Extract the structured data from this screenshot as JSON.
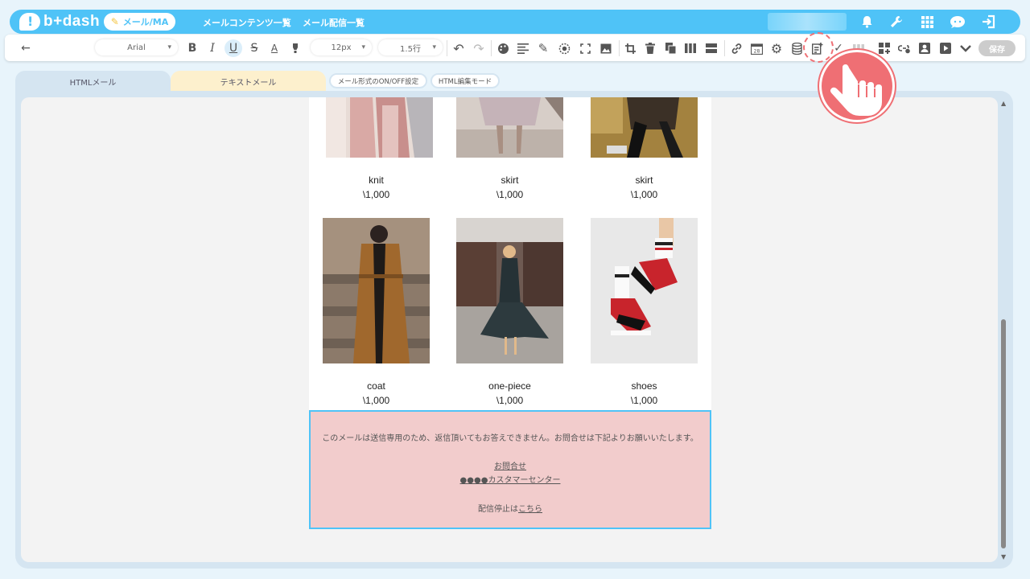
{
  "app": {
    "logo_text": "b+dash",
    "mode_label": "メール/MA",
    "nav": [
      "メールコンテンツ一覧",
      "メール配信一覧"
    ]
  },
  "toolbar": {
    "font_family": "Arial",
    "font_size": "12px",
    "line_height": "1.5行",
    "save_label": "保存"
  },
  "tabs": {
    "html_label": "HTMLメール",
    "text_label": "テキストメール",
    "toggle_label": "メール形式のON/OFF設定",
    "html_edit_label": "HTML編集モード"
  },
  "products": [
    {
      "name": "knit",
      "price": "\\1,000"
    },
    {
      "name": "skirt",
      "price": "\\1,000"
    },
    {
      "name": "skirt",
      "price": "\\1,000"
    },
    {
      "name": "coat",
      "price": "\\1,000"
    },
    {
      "name": "one-piece",
      "price": "\\1,000"
    },
    {
      "name": "shoes",
      "price": "\\1,000"
    }
  ],
  "footer": {
    "notice": "このメールは送信専用のため、返信頂いてもお答えできません。お問合せは下記よりお願いいたします。",
    "contact_link": "お問合せ",
    "center_link": "●●●●カスタマーセンター",
    "unsubscribe_prefix": "配信停止は",
    "unsubscribe_link": "こちら"
  },
  "colors": {
    "brand": "#4fc3f7",
    "callout": "#ef6f74",
    "footer_bg": "#f2cccc"
  }
}
